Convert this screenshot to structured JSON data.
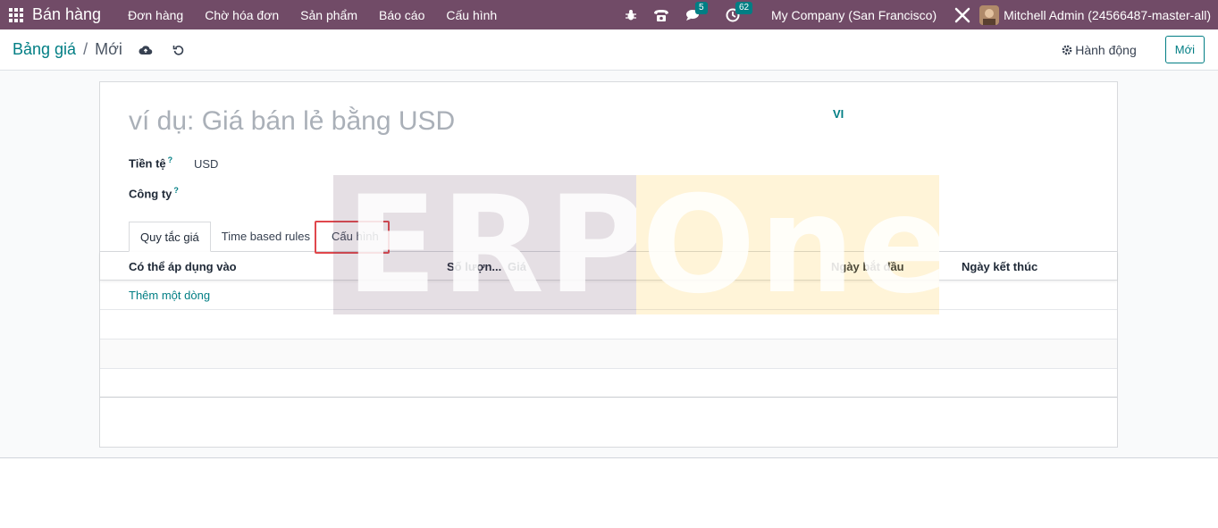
{
  "navbar": {
    "app_name": "Bán hàng",
    "menu": [
      "Đơn hàng",
      "Chờ hóa đơn",
      "Sản phẩm",
      "Báo cáo",
      "Cấu hình"
    ],
    "messages_count": "5",
    "activities_count": "62",
    "company": "My Company (San Francisco)",
    "user": "Mitchell Admin (24566487-master-all)"
  },
  "breadcrumb": {
    "parent": "Bảng giá",
    "separator": "/",
    "current": "Mới"
  },
  "toolbar": {
    "action_label": "Hành động",
    "new_label": "Mới"
  },
  "form": {
    "name_placeholder": "ví dụ: Giá bán lẻ bằng USD",
    "language": "VI",
    "currency_label": "Tiền tệ",
    "currency_value": "USD",
    "company_label": "Công ty",
    "help_mark": "?"
  },
  "tabs": [
    {
      "label": "Quy tắc giá",
      "active": true
    },
    {
      "label": "Time based rules",
      "active": false
    },
    {
      "label": "Cấu hình",
      "active": false
    }
  ],
  "table": {
    "columns": [
      "Có thể áp dụng vào",
      "Số lượn...",
      "Giá",
      "Ngày bắt đầu",
      "Ngày kết thúc"
    ],
    "add_line": "Thêm một dòng"
  },
  "watermark": {
    "left": "ERP",
    "right": "One"
  },
  "colors": {
    "navbar": "#714b67",
    "accent": "#017e84",
    "highlight": "#e0474c"
  }
}
